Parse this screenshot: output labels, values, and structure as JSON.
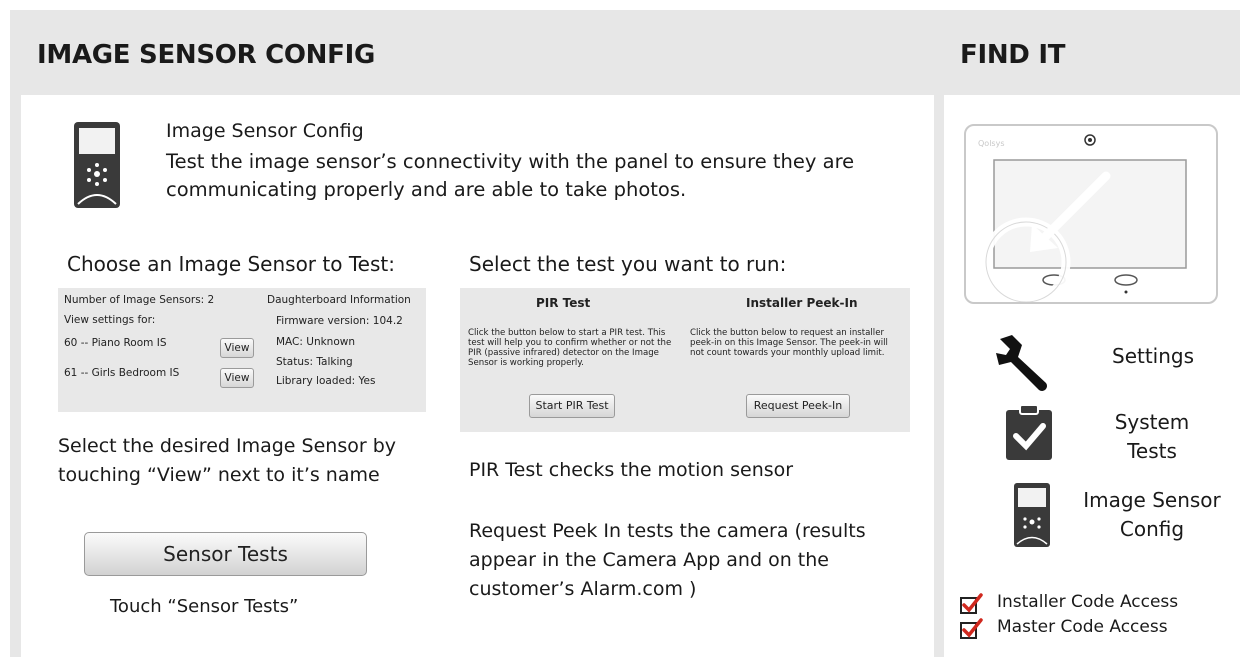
{
  "header": {
    "title_left": "IMAGE SENSOR CONFIG",
    "title_right": "FIND IT"
  },
  "intro": {
    "title": "Image Sensor Config",
    "description": "Test the image sensor’s connectivity with the panel to ensure they are communicating properly and are able to take photos."
  },
  "choose_section": {
    "heading": "Choose an Image Sensor to Test:",
    "screen": {
      "count_label": "Number of Image Sensors: 2",
      "view_settings_label": "View settings for:",
      "sensors": [
        {
          "name": "60 -- Piano Room IS",
          "button": "View"
        },
        {
          "name": "61 -- Girls Bedroom IS",
          "button": "View"
        }
      ],
      "db_title": "Daughterboard Information",
      "firmware": "Firmware version: 104.2",
      "mac": "MAC: Unknown",
      "status": "Status: Talking",
      "library": "Library loaded: Yes"
    },
    "instruction": "Select the desired Image Sensor by touching “View” next to it’s name",
    "button_label": "Sensor Tests",
    "touch_hint": "Touch “Sensor Tests”"
  },
  "test_section": {
    "heading": "Select the test you want to run:",
    "screen": {
      "pir_title": "PIR Test",
      "pir_desc": "Click the button below to start a PIR test. This test will help you to confirm whether or not the PIR (passive infrared) detector on the Image Sensor is working properly.",
      "pir_button": "Start PIR Test",
      "peek_title": "Installer Peek-In",
      "peek_desc": "Click the button below to request an installer peek-in on this Image Sensor. The peek-in will not count towards your monthly upload limit.",
      "peek_button": "Request Peek-In"
    },
    "pir_note": "PIR Test checks the motion sensor",
    "peek_note": "Request Peek In tests the camera (results appear in the Camera App and on the customer’s Alarm.com  )"
  },
  "find_it": {
    "nav_settings": "Settings",
    "nav_system_tests": "System Tests",
    "nav_image_sensor": "Image Sensor Config",
    "access": [
      {
        "label": "Installer Code Access",
        "checked": true
      },
      {
        "label": "Master Code Access",
        "checked": true
      }
    ]
  },
  "colors": {
    "background_band": "#e7e7e7",
    "checkmark": "#d0281e",
    "icon_dark": "#3a3a3a"
  }
}
